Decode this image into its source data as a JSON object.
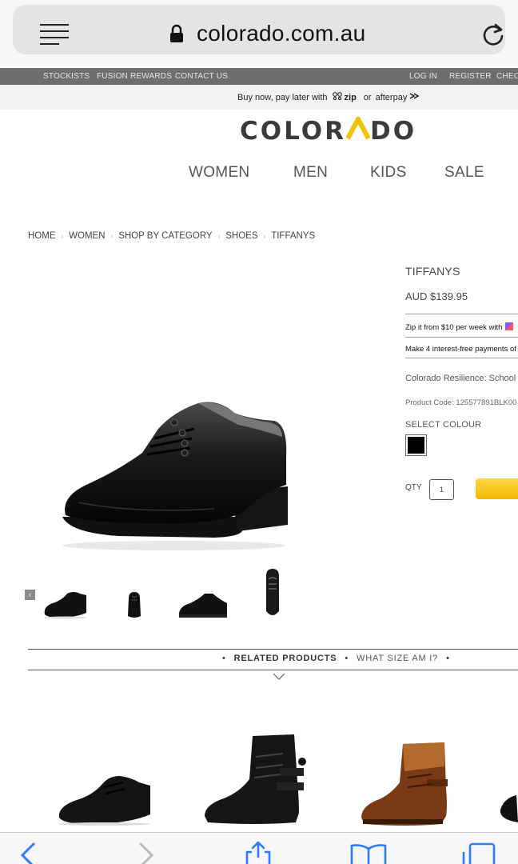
{
  "browser": {
    "url": "colorado.com.au",
    "icons": {
      "menu": "menu-icon",
      "lock": "lock-icon",
      "reload": "reload-icon"
    }
  },
  "util_nav": {
    "left": [
      "STOCKISTS",
      "FUSION REWARDS",
      "CONTACT US"
    ],
    "right": [
      "LOG IN",
      "REGISTER",
      "CHEC"
    ]
  },
  "promo": {
    "prefix": "Buy now, pay later with",
    "zip": "zip",
    "or": "or",
    "afterpay": "afterpay"
  },
  "logo": {
    "before": "COLOR",
    "accent": "A",
    "after": "DO",
    "accent_color": "#f3c300"
  },
  "main_nav": [
    "WOMEN",
    "MEN",
    "KIDS",
    "SALE"
  ],
  "breadcrumb": [
    "HOME",
    "WOMEN",
    "SHOP BY CATEGORY",
    "SHOES",
    "TIFFANYS"
  ],
  "product": {
    "title": "TIFFANYS",
    "price": "AUD $139.95",
    "zip_text": "Zip it from $10 per week with",
    "afterpay_text": "Make 4 interest-free payments of",
    "description": "Colorado Resilience: School",
    "code": "Product Code: 125577891BLK00",
    "colour_label": "SELECT COLOUR",
    "colour": "#000000",
    "qty_label": "QTY",
    "qty_value": "1",
    "add_button_color": "#f5b800"
  },
  "thumbnails": {
    "prev_glyph": "‹",
    "count": 4
  },
  "tabs": {
    "related": "RELATED PRODUCTS",
    "size": "WHAT SIZE AM I?",
    "dot": "•"
  },
  "bottom_bar": {
    "icons": [
      "back-icon",
      "forward-icon",
      "share-icon",
      "bookmarks-icon",
      "tabs-icon"
    ]
  }
}
